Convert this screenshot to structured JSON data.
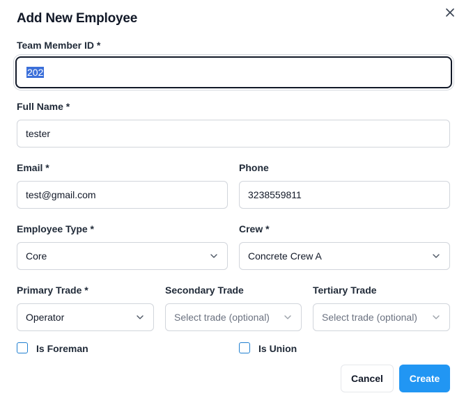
{
  "dialog": {
    "title": "Add New Employee"
  },
  "fields": {
    "team_member_id": {
      "label": "Team Member ID *",
      "value": "202"
    },
    "full_name": {
      "label": "Full Name *",
      "value": "tester"
    },
    "email": {
      "label": "Email *",
      "value": "test@gmail.com"
    },
    "phone": {
      "label": "Phone",
      "value": "3238559811"
    },
    "employee_type": {
      "label": "Employee Type *",
      "value": "Core"
    },
    "crew": {
      "label": "Crew *",
      "value": "Concrete Crew A"
    },
    "primary_trade": {
      "label": "Primary Trade *",
      "value": "Operator"
    },
    "secondary_trade": {
      "label": "Secondary Trade",
      "placeholder": "Select trade (optional)"
    },
    "tertiary_trade": {
      "label": "Tertiary Trade",
      "placeholder": "Select trade (optional)"
    }
  },
  "checkboxes": {
    "is_foreman": {
      "label": "Is Foreman",
      "checked": false
    },
    "is_union": {
      "label": "Is Union",
      "checked": false
    }
  },
  "buttons": {
    "cancel": "Cancel",
    "create": "Create"
  },
  "colors": {
    "primary": "#2196f3",
    "checkbox_border": "#1f7fd0",
    "text_selection": "#3b6fd9"
  },
  "icons": {
    "close": "close-icon",
    "dropdown": "chevron-down-icon"
  }
}
